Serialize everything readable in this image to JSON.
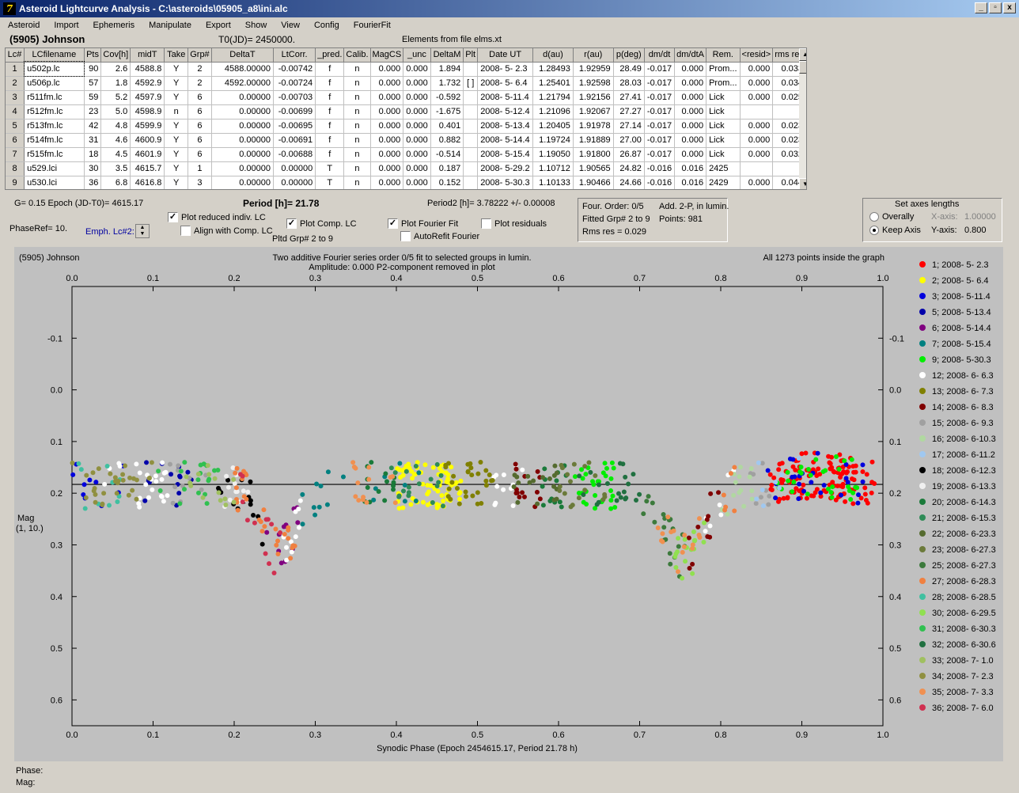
{
  "window": {
    "title": "Asteroid Lightcurve Analysis - C:\\asteroids\\05905_a8\\ini.alc",
    "icon_glyph": "7",
    "buttons": [
      "_",
      "▫",
      "x"
    ]
  },
  "menu": [
    "Asteroid",
    "Import",
    "Ephemeris",
    "Manipulate",
    "Export",
    "Show",
    "View",
    "Config",
    "FourierFit"
  ],
  "header": {
    "asteroid_name": "(5905) Johnson",
    "t0": "T0(JD)= 2450000.",
    "elements": "Elements from file elms.xt"
  },
  "table": {
    "columns": [
      "Lc#",
      "LCfilename",
      "Pts",
      "Cov[h]",
      "midT",
      "Take",
      "Grp#",
      "DeltaT",
      "LtCorr.",
      "_pred.",
      "Calib.",
      "MagCS",
      "_unc",
      "DeltaM",
      "Plt",
      "Date UT",
      "d(au)",
      "r(au)",
      "p(deg)",
      "dm/dt",
      "dm/dtA",
      "Rem.",
      "<resid>",
      "rms res"
    ],
    "rows": [
      [
        "1",
        "u502p.lc",
        "90",
        "2.6",
        "4588.8",
        "Y",
        "2",
        "4588.00000",
        "-0.00742",
        "f",
        "n",
        "0.000",
        "0.000",
        "1.894",
        "",
        "2008- 5- 2.3",
        "1.28493",
        "1.92959",
        "28.49",
        "-0.017",
        "0.000",
        "Prom...",
        "0.000",
        "0.033"
      ],
      [
        "2",
        "u506p.lc",
        "57",
        "1.8",
        "4592.9",
        "Y",
        "2",
        "4592.00000",
        "-0.00724",
        "f",
        "n",
        "0.000",
        "0.000",
        "1.732",
        "[ ]",
        "2008- 5- 6.4",
        "1.25401",
        "1.92598",
        "28.03",
        "-0.017",
        "0.000",
        "Prom...",
        "0.000",
        "0.034"
      ],
      [
        "3",
        "r511fm.lc",
        "59",
        "5.2",
        "4597.9",
        "Y",
        "6",
        "0.00000",
        "-0.00703",
        "f",
        "n",
        "0.000",
        "0.000",
        "-0.592",
        "",
        "2008- 5-11.4",
        "1.21794",
        "1.92156",
        "27.41",
        "-0.017",
        "0.000",
        "Lick",
        "0.000",
        "0.025"
      ],
      [
        "4",
        "r512fm.lc",
        "23",
        "5.0",
        "4598.9",
        "n",
        "6",
        "0.00000",
        "-0.00699",
        "f",
        "n",
        "0.000",
        "0.000",
        "-1.675",
        "",
        "2008- 5-12.4",
        "1.21096",
        "1.92067",
        "27.27",
        "-0.017",
        "0.000",
        "Lick",
        "",
        ""
      ],
      [
        "5",
        "r513fm.lc",
        "42",
        "4.8",
        "4599.9",
        "Y",
        "6",
        "0.00000",
        "-0.00695",
        "f",
        "n",
        "0.000",
        "0.000",
        "0.401",
        "",
        "2008- 5-13.4",
        "1.20405",
        "1.91978",
        "27.14",
        "-0.017",
        "0.000",
        "Lick",
        "0.000",
        "0.023"
      ],
      [
        "6",
        "r514fm.lc",
        "31",
        "4.6",
        "4600.9",
        "Y",
        "6",
        "0.00000",
        "-0.00691",
        "f",
        "n",
        "0.000",
        "0.000",
        "0.882",
        "",
        "2008- 5-14.4",
        "1.19724",
        "1.91889",
        "27.00",
        "-0.017",
        "0.000",
        "Lick",
        "0.000",
        "0.023"
      ],
      [
        "7",
        "r515fm.lc",
        "18",
        "4.5",
        "4601.9",
        "Y",
        "6",
        "0.00000",
        "-0.00688",
        "f",
        "n",
        "0.000",
        "0.000",
        "-0.514",
        "",
        "2008- 5-15.4",
        "1.19050",
        "1.91800",
        "26.87",
        "-0.017",
        "0.000",
        "Lick",
        "0.000",
        "0.032"
      ],
      [
        "8",
        "u529.lci",
        "30",
        "3.5",
        "4615.7",
        "Y",
        "1",
        "0.00000",
        "0.00000",
        "T",
        "n",
        "0.000",
        "0.000",
        "0.187",
        "",
        "2008- 5-29.2",
        "1.10712",
        "1.90565",
        "24.82",
        "-0.016",
        "0.016",
        "2425",
        "",
        ""
      ],
      [
        "9",
        "u530.lci",
        "36",
        "6.8",
        "4616.8",
        "Y",
        "3",
        "0.00000",
        "0.00000",
        "T",
        "n",
        "0.000",
        "0.000",
        "0.152",
        "",
        "2008- 5-30.3",
        "1.10133",
        "1.90466",
        "24.66",
        "-0.016",
        "0.016",
        "2429",
        "0.000",
        "0.044"
      ]
    ]
  },
  "controls": {
    "g_epoch": "G= 0.15    Epoch (JD-T0)= 4615.17",
    "period": "Period [h]= 21.78",
    "period2": "Period2 [h]= 3.78222 +/- 0.00008",
    "phaseref": "PhaseRef= 10.",
    "emph": "Emph. Lc#2:",
    "plot_reduced": "Plot reduced indiv. LC",
    "align_comp": "Align with Comp. LC",
    "plot_comp": "Plot Comp. LC",
    "pltd_grp": "Pltd Grp#  2   to   9",
    "plot_fourier": "Plot Fourier Fit",
    "autorefit": "AutoRefit Fourier",
    "plot_resid": "Plot residuals",
    "four_order": "Four. Order:  0/5",
    "add2p": "Add. 2-P, in lumin.",
    "fitted_grp": "Fitted Grp# 2 to 9",
    "points": "Points: 981",
    "rms": "Rms res      = 0.029",
    "axes_title": "Set axes lengths",
    "overally": "Overally",
    "keep_axis": "Keep Axis",
    "xaxis_label": "X-axis:",
    "xaxis_val": "1.00000",
    "yaxis_label": "Y-axis:",
    "yaxis_val": "0.800"
  },
  "graph": {
    "name": "(5905) Johnson",
    "subtitle1": "Two additive Fourier series order 0/5 fit to selected groups in lumin.",
    "subtitle2": "Amplitude: 0.000                         P2-component removed in plot",
    "points_inside": "All 1273 points inside the graph",
    "ylabel1": "Mag",
    "ylabel2": "(1, 10.)",
    "xlabel": "Synodic Phase (Epoch 2454615.17, Period 21.78 h)"
  },
  "chart_data": {
    "type": "scatter",
    "x_range": [
      0,
      1
    ],
    "y_range": [
      -0.2,
      0.65
    ],
    "y_inverted": true,
    "x_ticks": [
      "0.0",
      "0.1",
      "0.2",
      "0.3",
      "0.4",
      "0.5",
      "0.6",
      "0.7",
      "0.8",
      "0.9",
      "1.0"
    ],
    "y_ticks": [
      "-0.1",
      "0.0",
      "0.1",
      "0.2",
      "0.3",
      "0.4",
      "0.5",
      "0.6"
    ],
    "fit_line_mag": 0.183,
    "series": [
      {
        "name": "1; 2008- 5- 2.3",
        "color": "#ff0000",
        "ranges": [
          [
            0.86,
            0.99,
            120
          ]
        ]
      },
      {
        "name": "2; 2008- 5- 6.4",
        "color": "#ffff00",
        "ranges": [
          [
            0.4,
            0.48,
            70
          ]
        ]
      },
      {
        "name": "3; 2008- 5-11.4",
        "color": "#0000dd",
        "ranges": [
          [
            0.0,
            0.07,
            10
          ],
          [
            0.85,
            0.98,
            25
          ]
        ]
      },
      {
        "name": "5; 2008- 5-13.4",
        "color": "#0000aa",
        "ranges": [
          [
            0.08,
            0.15,
            14
          ]
        ]
      },
      {
        "name": "6; 2008- 5-14.4",
        "color": "#800080",
        "ranges": [
          [
            0.24,
            0.28,
            12
          ]
        ]
      },
      {
        "name": "7; 2008- 5-15.4",
        "color": "#008080",
        "ranges": [
          [
            0.28,
            0.34,
            10
          ],
          [
            0.36,
            0.44,
            8
          ]
        ]
      },
      {
        "name": "9; 2008- 5-30.3",
        "color": "#00ee00",
        "ranges": [
          [
            0.62,
            0.67,
            30
          ],
          [
            0.86,
            0.97,
            30
          ]
        ]
      },
      {
        "name": "12; 2008- 6- 6.3",
        "color": "#ffffff",
        "ranges": [
          [
            0.04,
            0.12,
            24
          ],
          [
            0.26,
            0.3,
            10
          ],
          [
            0.52,
            0.56,
            12
          ],
          [
            0.78,
            0.82,
            8
          ]
        ]
      },
      {
        "name": "13; 2008- 6- 7.3",
        "color": "#808000",
        "ranges": [
          [
            0.46,
            0.52,
            30
          ]
        ]
      },
      {
        "name": "14; 2008- 6- 8.3",
        "color": "#800000",
        "ranges": [
          [
            0.54,
            0.58,
            14
          ],
          [
            0.76,
            0.8,
            10
          ]
        ]
      },
      {
        "name": "15; 2008- 6- 9.3",
        "color": "#a0a0a0",
        "ranges": [
          [
            0.12,
            0.18,
            10
          ],
          [
            0.82,
            0.86,
            8
          ]
        ]
      },
      {
        "name": "16; 2008- 6-10.3",
        "color": "#b0d8a0",
        "ranges": [
          [
            0.8,
            0.84,
            14
          ]
        ]
      },
      {
        "name": "17; 2008- 6-11.2",
        "color": "#a0c8f0",
        "ranges": [
          [
            0.84,
            0.9,
            8
          ]
        ]
      },
      {
        "name": "18; 2008- 6-12.3",
        "color": "#000000",
        "ranges": [
          [
            0.18,
            0.24,
            16
          ]
        ]
      },
      {
        "name": "19; 2008- 6-13.3",
        "color": "#f0f0f0",
        "ranges": [
          [
            0.18,
            0.22,
            14
          ]
        ]
      },
      {
        "name": "20; 2008- 6-14.3",
        "color": "#1a7a3a",
        "ranges": [
          [
            0.36,
            0.4,
            14
          ],
          [
            0.58,
            0.62,
            14
          ]
        ]
      },
      {
        "name": "21; 2008- 6-15.3",
        "color": "#2e8b57",
        "ranges": [
          [
            0.38,
            0.46,
            18
          ]
        ]
      },
      {
        "name": "22; 2008- 6-23.3",
        "color": "#556b2f",
        "ranges": [
          [
            0.54,
            0.6,
            18
          ]
        ]
      },
      {
        "name": "23; 2008- 6-27.3",
        "color": "#6b7a3a",
        "ranges": [
          [
            0.6,
            0.66,
            18
          ]
        ]
      },
      {
        "name": "25; 2008- 6-27.3",
        "color": "#3c7a3c",
        "ranges": [
          [
            0.7,
            0.76,
            20
          ]
        ]
      },
      {
        "name": "27; 2008- 6-28.3",
        "color": "#f08040",
        "ranges": [
          [
            0.2,
            0.28,
            30
          ],
          [
            0.8,
            0.82,
            6
          ]
        ]
      },
      {
        "name": "28; 2008- 6-28.5",
        "color": "#40c0a0",
        "ranges": [
          [
            0.0,
            0.06,
            10
          ]
        ]
      },
      {
        "name": "30; 2008- 6-29.5",
        "color": "#90e050",
        "ranges": [
          [
            0.74,
            0.78,
            18
          ]
        ]
      },
      {
        "name": "31; 2008- 6-30.3",
        "color": "#30c050",
        "ranges": [
          [
            0.1,
            0.18,
            18
          ]
        ]
      },
      {
        "name": "32; 2008- 6-30.6",
        "color": "#207040",
        "ranges": [
          [
            0.62,
            0.7,
            20
          ]
        ]
      },
      {
        "name": "33; 2008- 7- 1.0",
        "color": "#a0c060",
        "ranges": [
          [
            0.14,
            0.2,
            14
          ]
        ]
      },
      {
        "name": "34; 2008- 7- 2.3",
        "color": "#909040",
        "ranges": [
          [
            0.0,
            0.1,
            30
          ]
        ]
      },
      {
        "name": "35; 2008- 7- 3.3",
        "color": "#f09050",
        "ranges": [
          [
            0.34,
            0.4,
            14
          ],
          [
            0.72,
            0.78,
            16
          ]
        ]
      },
      {
        "name": "36; 2008- 7- 6.0",
        "color": "#d03050",
        "ranges": [
          [
            0.2,
            0.26,
            12
          ]
        ]
      }
    ]
  },
  "status": {
    "phase": "Phase:",
    "mag": "Mag:"
  }
}
